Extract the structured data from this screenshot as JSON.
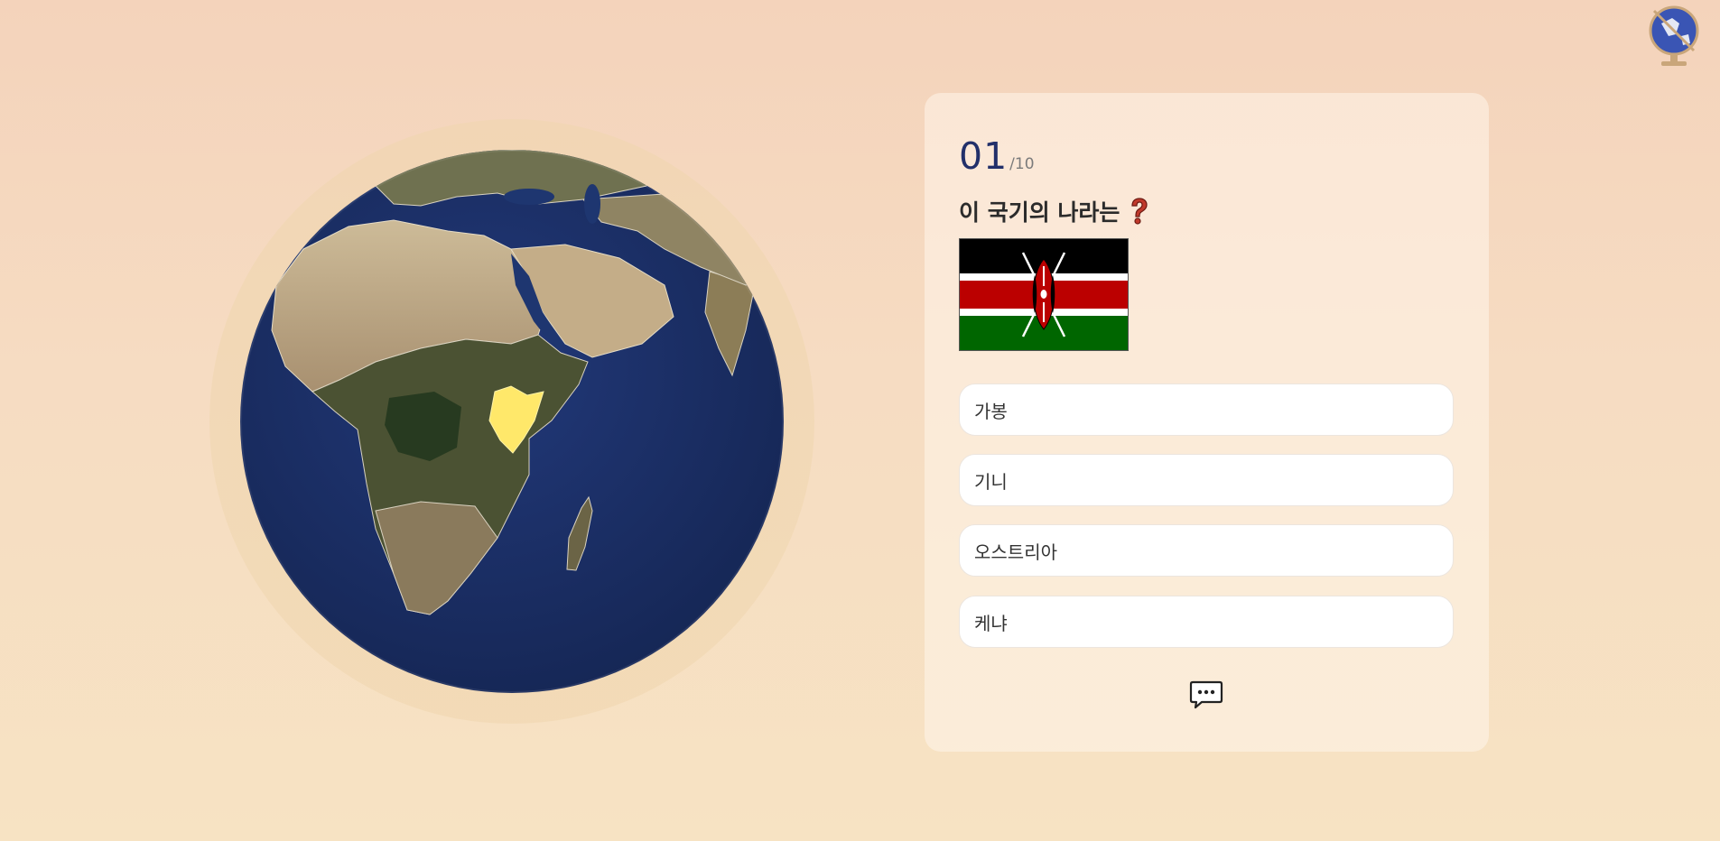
{
  "quiz": {
    "current": "01",
    "total": "/10",
    "question": "이 국기의 나라는",
    "question_icon": "question-mark-icon",
    "flag": {
      "country": "Kenya",
      "colors": {
        "black": "#000000",
        "red": "#bb0000",
        "green": "#006600",
        "white": "#ffffff"
      }
    },
    "options": [
      "가봉",
      "기니",
      "오스트리아",
      "케냐"
    ]
  },
  "globe": {
    "highlighted_country": "Kenya",
    "highlight_color": "#ffe86a",
    "ocean_color": "#1c2f63"
  },
  "icons": {
    "logo": "globe-logo-icon",
    "hint": "speech-bubble-icon"
  }
}
